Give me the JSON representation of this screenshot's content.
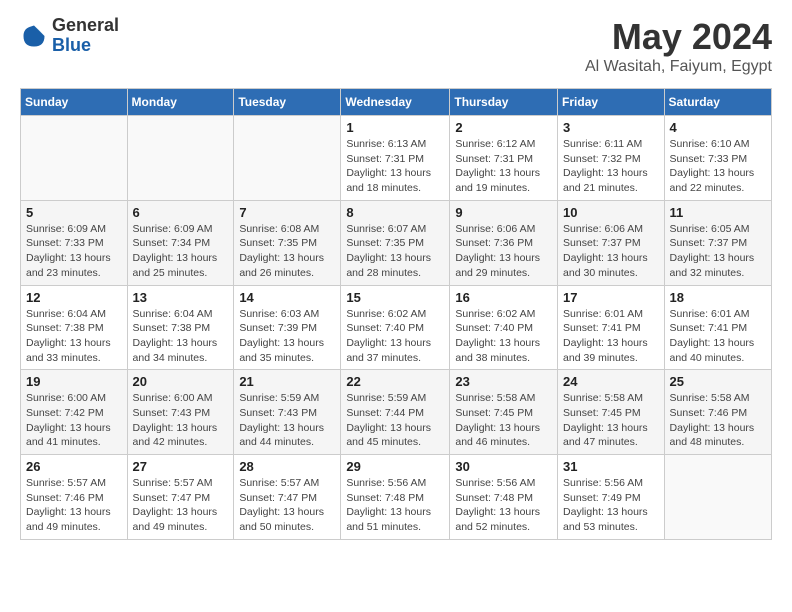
{
  "header": {
    "logo_general": "General",
    "logo_blue": "Blue",
    "title": "May 2024",
    "location": "Al Wasitah, Faiyum, Egypt"
  },
  "days_of_week": [
    "Sunday",
    "Monday",
    "Tuesday",
    "Wednesday",
    "Thursday",
    "Friday",
    "Saturday"
  ],
  "weeks": [
    [
      {
        "day": "",
        "info": ""
      },
      {
        "day": "",
        "info": ""
      },
      {
        "day": "",
        "info": ""
      },
      {
        "day": "1",
        "info": "Sunrise: 6:13 AM\nSunset: 7:31 PM\nDaylight: 13 hours and 18 minutes."
      },
      {
        "day": "2",
        "info": "Sunrise: 6:12 AM\nSunset: 7:31 PM\nDaylight: 13 hours and 19 minutes."
      },
      {
        "day": "3",
        "info": "Sunrise: 6:11 AM\nSunset: 7:32 PM\nDaylight: 13 hours and 21 minutes."
      },
      {
        "day": "4",
        "info": "Sunrise: 6:10 AM\nSunset: 7:33 PM\nDaylight: 13 hours and 22 minutes."
      }
    ],
    [
      {
        "day": "5",
        "info": "Sunrise: 6:09 AM\nSunset: 7:33 PM\nDaylight: 13 hours and 23 minutes."
      },
      {
        "day": "6",
        "info": "Sunrise: 6:09 AM\nSunset: 7:34 PM\nDaylight: 13 hours and 25 minutes."
      },
      {
        "day": "7",
        "info": "Sunrise: 6:08 AM\nSunset: 7:35 PM\nDaylight: 13 hours and 26 minutes."
      },
      {
        "day": "8",
        "info": "Sunrise: 6:07 AM\nSunset: 7:35 PM\nDaylight: 13 hours and 28 minutes."
      },
      {
        "day": "9",
        "info": "Sunrise: 6:06 AM\nSunset: 7:36 PM\nDaylight: 13 hours and 29 minutes."
      },
      {
        "day": "10",
        "info": "Sunrise: 6:06 AM\nSunset: 7:37 PM\nDaylight: 13 hours and 30 minutes."
      },
      {
        "day": "11",
        "info": "Sunrise: 6:05 AM\nSunset: 7:37 PM\nDaylight: 13 hours and 32 minutes."
      }
    ],
    [
      {
        "day": "12",
        "info": "Sunrise: 6:04 AM\nSunset: 7:38 PM\nDaylight: 13 hours and 33 minutes."
      },
      {
        "day": "13",
        "info": "Sunrise: 6:04 AM\nSunset: 7:38 PM\nDaylight: 13 hours and 34 minutes."
      },
      {
        "day": "14",
        "info": "Sunrise: 6:03 AM\nSunset: 7:39 PM\nDaylight: 13 hours and 35 minutes."
      },
      {
        "day": "15",
        "info": "Sunrise: 6:02 AM\nSunset: 7:40 PM\nDaylight: 13 hours and 37 minutes."
      },
      {
        "day": "16",
        "info": "Sunrise: 6:02 AM\nSunset: 7:40 PM\nDaylight: 13 hours and 38 minutes."
      },
      {
        "day": "17",
        "info": "Sunrise: 6:01 AM\nSunset: 7:41 PM\nDaylight: 13 hours and 39 minutes."
      },
      {
        "day": "18",
        "info": "Sunrise: 6:01 AM\nSunset: 7:41 PM\nDaylight: 13 hours and 40 minutes."
      }
    ],
    [
      {
        "day": "19",
        "info": "Sunrise: 6:00 AM\nSunset: 7:42 PM\nDaylight: 13 hours and 41 minutes."
      },
      {
        "day": "20",
        "info": "Sunrise: 6:00 AM\nSunset: 7:43 PM\nDaylight: 13 hours and 42 minutes."
      },
      {
        "day": "21",
        "info": "Sunrise: 5:59 AM\nSunset: 7:43 PM\nDaylight: 13 hours and 44 minutes."
      },
      {
        "day": "22",
        "info": "Sunrise: 5:59 AM\nSunset: 7:44 PM\nDaylight: 13 hours and 45 minutes."
      },
      {
        "day": "23",
        "info": "Sunrise: 5:58 AM\nSunset: 7:45 PM\nDaylight: 13 hours and 46 minutes."
      },
      {
        "day": "24",
        "info": "Sunrise: 5:58 AM\nSunset: 7:45 PM\nDaylight: 13 hours and 47 minutes."
      },
      {
        "day": "25",
        "info": "Sunrise: 5:58 AM\nSunset: 7:46 PM\nDaylight: 13 hours and 48 minutes."
      }
    ],
    [
      {
        "day": "26",
        "info": "Sunrise: 5:57 AM\nSunset: 7:46 PM\nDaylight: 13 hours and 49 minutes."
      },
      {
        "day": "27",
        "info": "Sunrise: 5:57 AM\nSunset: 7:47 PM\nDaylight: 13 hours and 49 minutes."
      },
      {
        "day": "28",
        "info": "Sunrise: 5:57 AM\nSunset: 7:47 PM\nDaylight: 13 hours and 50 minutes."
      },
      {
        "day": "29",
        "info": "Sunrise: 5:56 AM\nSunset: 7:48 PM\nDaylight: 13 hours and 51 minutes."
      },
      {
        "day": "30",
        "info": "Sunrise: 5:56 AM\nSunset: 7:48 PM\nDaylight: 13 hours and 52 minutes."
      },
      {
        "day": "31",
        "info": "Sunrise: 5:56 AM\nSunset: 7:49 PM\nDaylight: 13 hours and 53 minutes."
      },
      {
        "day": "",
        "info": ""
      }
    ]
  ]
}
